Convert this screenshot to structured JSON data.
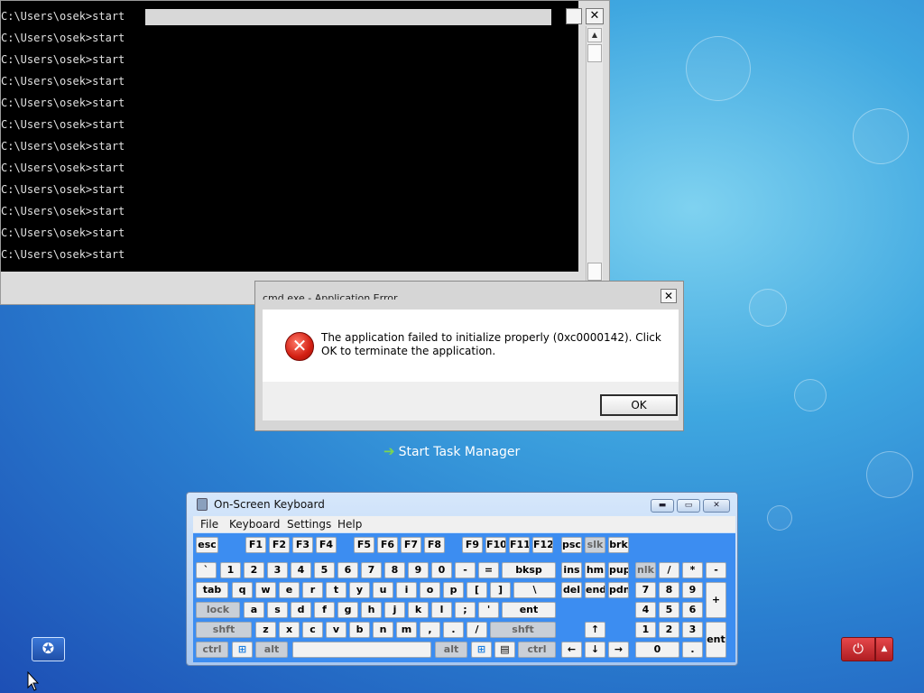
{
  "console": {
    "lines": [
      "C:\\Users\\osek>start",
      "C:\\Users\\osek>start",
      "C:\\Users\\osek>start",
      "C:\\Users\\osek>start",
      "C:\\Users\\osek>start",
      "C:\\Users\\osek>start",
      "C:\\Users\\osek>start",
      "C:\\Users\\osek>start",
      "C:\\Users\\osek>start",
      "C:\\Users\\osek>start",
      "C:\\Users\\osek>start",
      "C:\\Users\\osek>start"
    ],
    "close_glyph": "✕",
    "scroll_up_glyph": "▲",
    "scroll_down_glyph": "▼"
  },
  "dialog": {
    "title": "cmd.exe - Application Error",
    "close_glyph": "✕",
    "icon_glyph": "✕",
    "message": "The application failed to initialize properly (0xc0000142). Click OK to terminate the application.",
    "ok_label": "OK"
  },
  "task_manager": {
    "arrow_glyph": "➔",
    "label": "Start Task Manager"
  },
  "osk": {
    "title": "On-Screen Keyboard",
    "window_buttons": {
      "minimize": "▬",
      "maximize": "▭",
      "close": "✕"
    },
    "menu": [
      "File",
      "Keyboard",
      "Settings",
      "Help"
    ],
    "rows": [
      [
        "esc",
        "F1",
        "F2",
        "F3",
        "F4",
        "F5",
        "F6",
        "F7",
        "F8",
        "F9",
        "F10",
        "F11",
        "F12",
        "psc",
        "slk",
        "brk"
      ],
      [
        "`",
        "1",
        "2",
        "3",
        "4",
        "5",
        "6",
        "7",
        "8",
        "9",
        "0",
        "-",
        "=",
        "bksp",
        "ins",
        "hm",
        "pup",
        "nlk",
        "/",
        "*",
        "-"
      ],
      [
        "tab",
        "q",
        "w",
        "e",
        "r",
        "t",
        "y",
        "u",
        "i",
        "o",
        "p",
        "[",
        "]",
        "\\",
        "del",
        "end",
        "pdn",
        "7",
        "8",
        "9",
        "+"
      ],
      [
        "lock",
        "a",
        "s",
        "d",
        "f",
        "g",
        "h",
        "j",
        "k",
        "l",
        ";",
        "'",
        "ent",
        "4",
        "5",
        "6"
      ],
      [
        "shft",
        "z",
        "x",
        "c",
        "v",
        "b",
        "n",
        "m",
        ",",
        ".",
        "/",
        "shft",
        "↑",
        "1",
        "2",
        "3",
        "ent"
      ],
      [
        "ctrl",
        "⊞",
        "alt",
        "",
        "alt",
        "⊞",
        "▤",
        "ctrl",
        "←",
        "↓",
        "→",
        "0",
        "."
      ]
    ]
  },
  "taskbar": {
    "accessibility_glyph": "✪",
    "power_glyph": "⏻",
    "power_arrow_glyph": "▲"
  },
  "colors": {
    "desktop_accent": "#2a7fd0",
    "osk_keys_bg": "#3c8df1",
    "power_red": "#c8282d"
  }
}
